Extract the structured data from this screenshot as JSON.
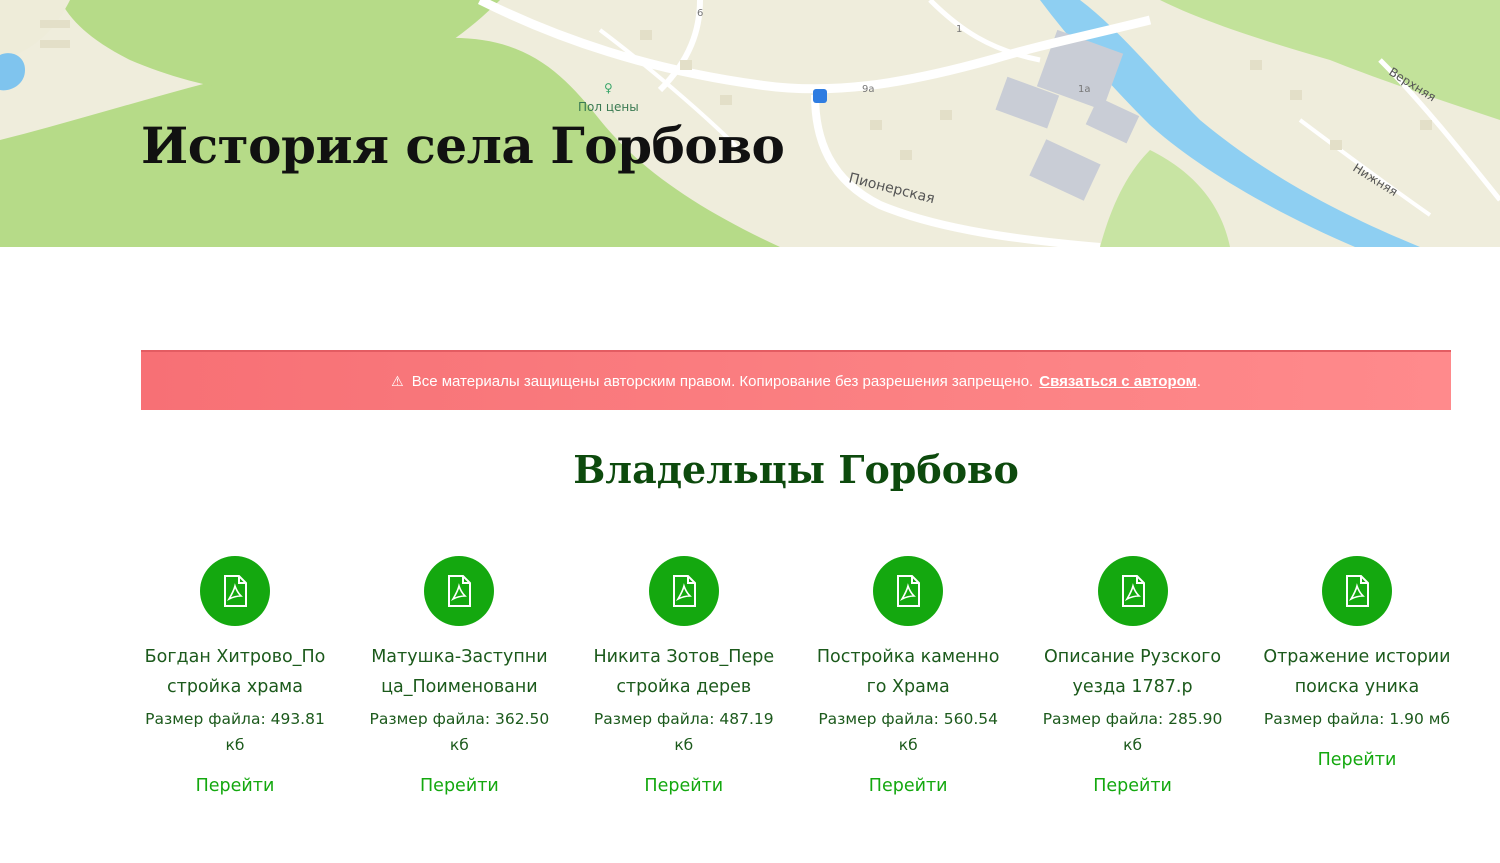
{
  "hero": {
    "title": "История села Горбово",
    "map_labels": {
      "poi": "Пол цены",
      "street_pionerskaya": "Пионерская",
      "street_verkhnyaya": "Верхняя",
      "street_nizhnyaya": "Нижняя",
      "house_9a": "9а",
      "house_1a": "1а",
      "house_1": "1",
      "house_6": "6"
    }
  },
  "notice": {
    "icon": "⚠",
    "text": "Все материалы защищены авторским правом. Копирование без разрешения запрещено.",
    "link_label": "Связаться с автором",
    "suffix": ".",
    "color": "#fb8183"
  },
  "section": {
    "title": "Владельцы Горбово"
  },
  "files": [
    {
      "name": "Богдан Хитрово_Постройка храма",
      "size": "Размер файла: 493.81 кб",
      "link": "Перейти",
      "icon": "pdf-icon"
    },
    {
      "name": "Матушка-Заступница_Поименовани",
      "size": "Размер файла: 362.50 кб",
      "link": "Перейти",
      "icon": "pdf-icon"
    },
    {
      "name": "Никита Зотов_Перестройка дерев",
      "size": "Размер файла: 487.19 кб",
      "link": "Перейти",
      "icon": "pdf-icon"
    },
    {
      "name": "Постройка каменного Храма",
      "size": "Размер файла: 560.54 кб",
      "link": "Перейти",
      "icon": "pdf-icon"
    },
    {
      "name": "Описание Рузского уезда 1787.р",
      "size": "Размер файла: 285.90 кб",
      "link": "Перейти",
      "icon": "pdf-icon"
    },
    {
      "name": "Отражение истории поиска уника",
      "size": "Размер файла: 1.90 мб",
      "link": "Перейти",
      "icon": "pdf-icon"
    }
  ],
  "colors": {
    "accent_green": "#14a80f",
    "heading_green": "#0d4a0d",
    "text_green": "#1c5a1c"
  }
}
